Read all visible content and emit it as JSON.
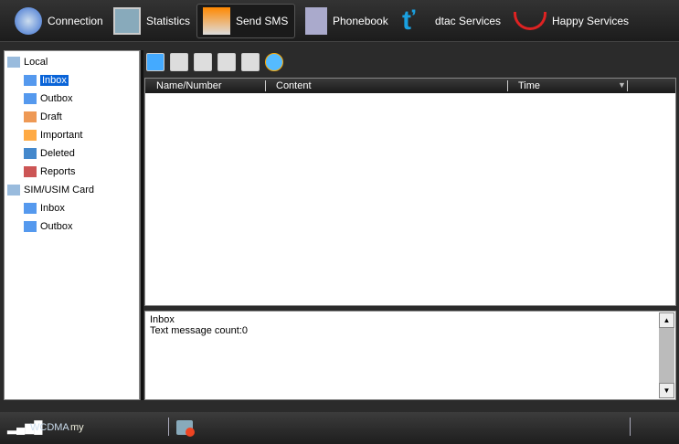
{
  "nav": [
    {
      "label": "Connection",
      "icon": "refresh-icon"
    },
    {
      "label": "Statistics",
      "icon": "monitor-chart-icon"
    },
    {
      "label": "Send SMS",
      "icon": "envelope-icon"
    },
    {
      "label": "Phonebook",
      "icon": "phonebook-icon"
    },
    {
      "label": "dtac Services",
      "icon": "dtac-logo-icon"
    },
    {
      "label": "Happy Services",
      "icon": "happy-logo-icon"
    }
  ],
  "tree": {
    "local": "Local",
    "local_items": [
      "Inbox",
      "Outbox",
      "Draft",
      "Important",
      "Deleted",
      "Reports"
    ],
    "sim": "SIM/USIM Card",
    "sim_items": [
      "Inbox",
      "Outbox"
    ]
  },
  "columns": [
    "Name/Number",
    "Content",
    "Time"
  ],
  "info": {
    "folder": "Inbox",
    "count": "Text message count:0"
  },
  "status": {
    "network": "WCDMA",
    "operator": "my"
  }
}
